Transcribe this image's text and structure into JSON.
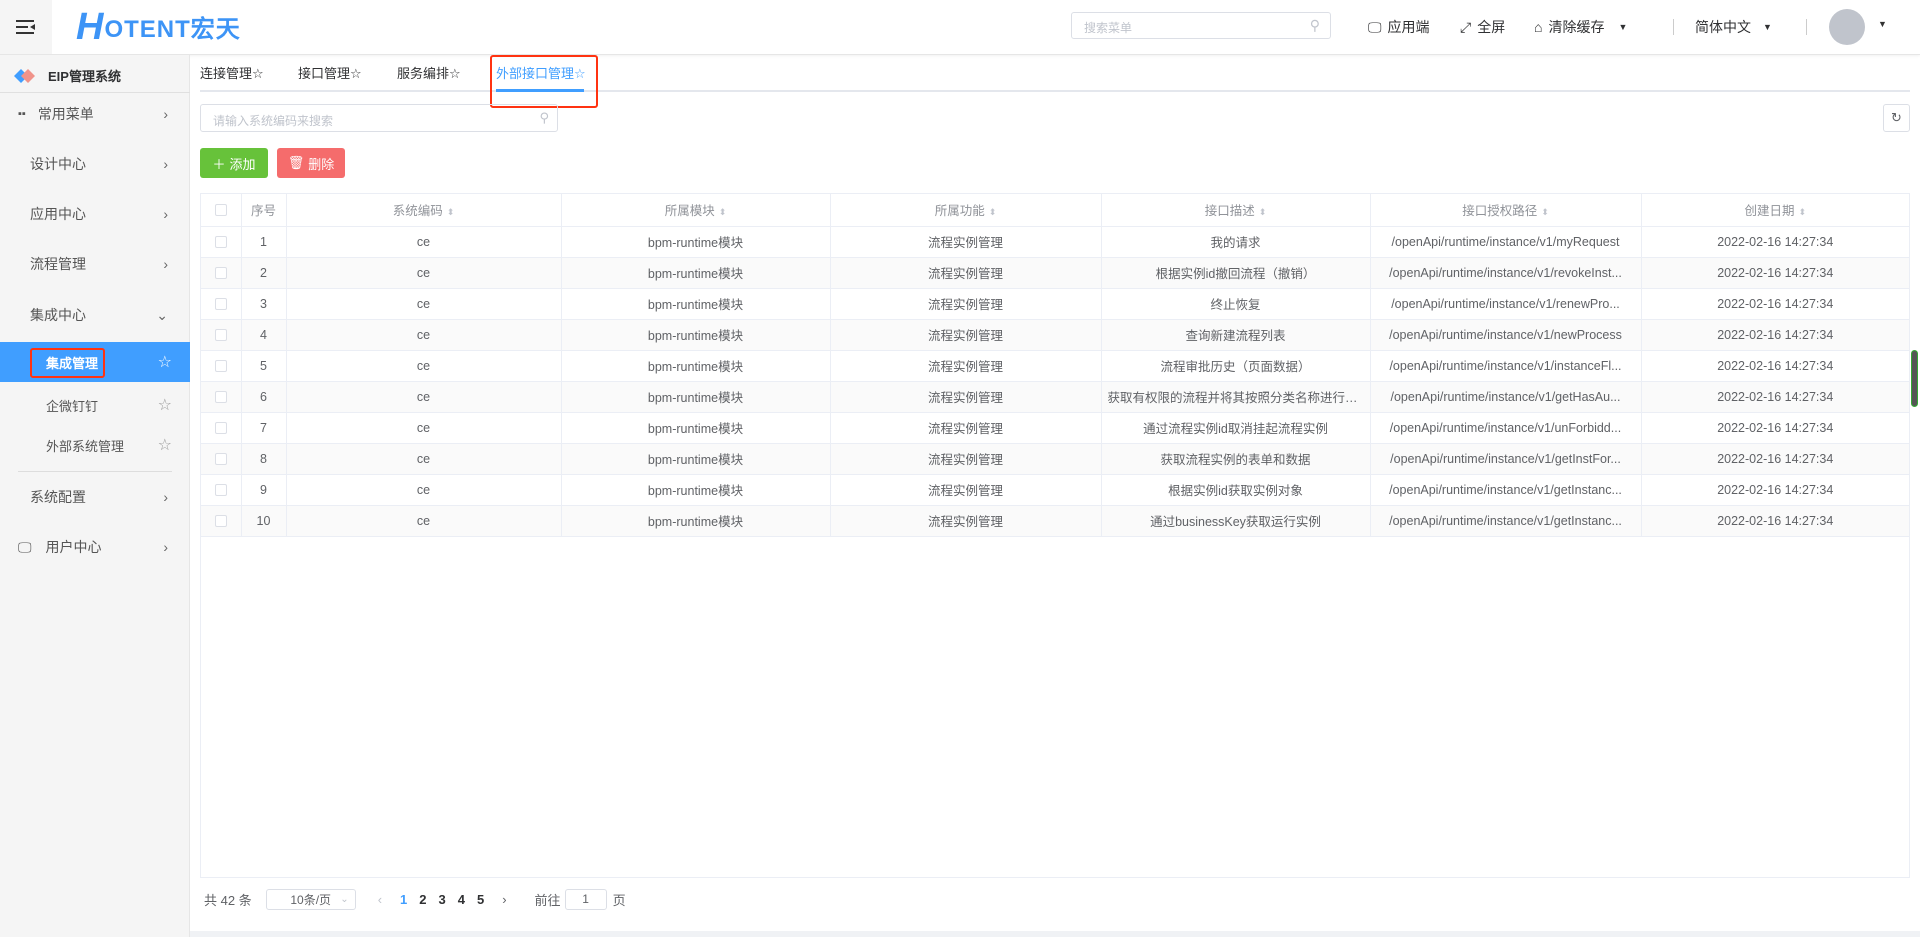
{
  "header": {
    "logo": "HOTENT宏天",
    "search_placeholder": "搜索菜单",
    "app_label": "应用端",
    "fullscreen_label": "全屏",
    "clear_cache_label": "清除缓存",
    "language": "简体中文"
  },
  "sidebar": {
    "title": "EIP管理系统",
    "items": [
      {
        "label": "常用菜单"
      },
      {
        "label": "设计中心"
      },
      {
        "label": "应用中心"
      },
      {
        "label": "流程管理"
      },
      {
        "label": "集成中心"
      },
      {
        "label": "集成管理"
      },
      {
        "label": "企微钉钉"
      },
      {
        "label": "外部系统管理"
      },
      {
        "label": "系统配置"
      },
      {
        "label": "用户中心"
      }
    ]
  },
  "tabs": [
    {
      "label": "连接管理☆"
    },
    {
      "label": "接口管理☆"
    },
    {
      "label": "服务编排☆"
    },
    {
      "label": "外部接口管理☆"
    }
  ],
  "toolbar": {
    "search_placeholder": "请输入系统编码来搜索",
    "add_label": "添加",
    "delete_label": "删除"
  },
  "table": {
    "columns": [
      "序号",
      "系统编码",
      "所属模块",
      "所属功能",
      "接口描述",
      "接口授权路径",
      "创建日期"
    ],
    "rows": [
      [
        "1",
        "ce",
        "bpm-runtime模块",
        "流程实例管理",
        "我的请求",
        "/openApi/runtime/instance/v1/myRequest",
        "2022-02-16 14:27:34"
      ],
      [
        "2",
        "ce",
        "bpm-runtime模块",
        "流程实例管理",
        "根据实例id撤回流程（撤销）",
        "/openApi/runtime/instance/v1/revokeInst...",
        "2022-02-16 14:27:34"
      ],
      [
        "3",
        "ce",
        "bpm-runtime模块",
        "流程实例管理",
        "终止恢复",
        "/openApi/runtime/instance/v1/renewPro...",
        "2022-02-16 14:27:34"
      ],
      [
        "4",
        "ce",
        "bpm-runtime模块",
        "流程实例管理",
        "查询新建流程列表",
        "/openApi/runtime/instance/v1/newProcess",
        "2022-02-16 14:27:34"
      ],
      [
        "5",
        "ce",
        "bpm-runtime模块",
        "流程实例管理",
        "流程审批历史（页面数据）",
        "/openApi/runtime/instance/v1/instanceFl...",
        "2022-02-16 14:27:34"
      ],
      [
        "6",
        "ce",
        "bpm-runtime模块",
        "流程实例管理",
        "获取有权限的流程并将其按照分类名称进行分...",
        "/openApi/runtime/instance/v1/getHasAu...",
        "2022-02-16 14:27:34"
      ],
      [
        "7",
        "ce",
        "bpm-runtime模块",
        "流程实例管理",
        "通过流程实例id取消挂起流程实例",
        "/openApi/runtime/instance/v1/unForbidd...",
        "2022-02-16 14:27:34"
      ],
      [
        "8",
        "ce",
        "bpm-runtime模块",
        "流程实例管理",
        "获取流程实例的表单和数据",
        "/openApi/runtime/instance/v1/getInstFor...",
        "2022-02-16 14:27:34"
      ],
      [
        "9",
        "ce",
        "bpm-runtime模块",
        "流程实例管理",
        "根据实例id获取实例对象",
        "/openApi/runtime/instance/v1/getInstanc...",
        "2022-02-16 14:27:34"
      ],
      [
        "10",
        "ce",
        "bpm-runtime模块",
        "流程实例管理",
        "通过businessKey获取运行实例",
        "/openApi/runtime/instance/v1/getInstanc...",
        "2022-02-16 14:27:34"
      ]
    ]
  },
  "pagination": {
    "total": "共 42 条",
    "page_size": "10条/页",
    "pages": [
      "1",
      "2",
      "3",
      "4",
      "5"
    ],
    "goto_label": "前往",
    "goto_value": "1",
    "page_unit": "页"
  },
  "colors": {
    "accent": "#409eff",
    "add": "#67c23a",
    "delete": "#f56c6c"
  }
}
